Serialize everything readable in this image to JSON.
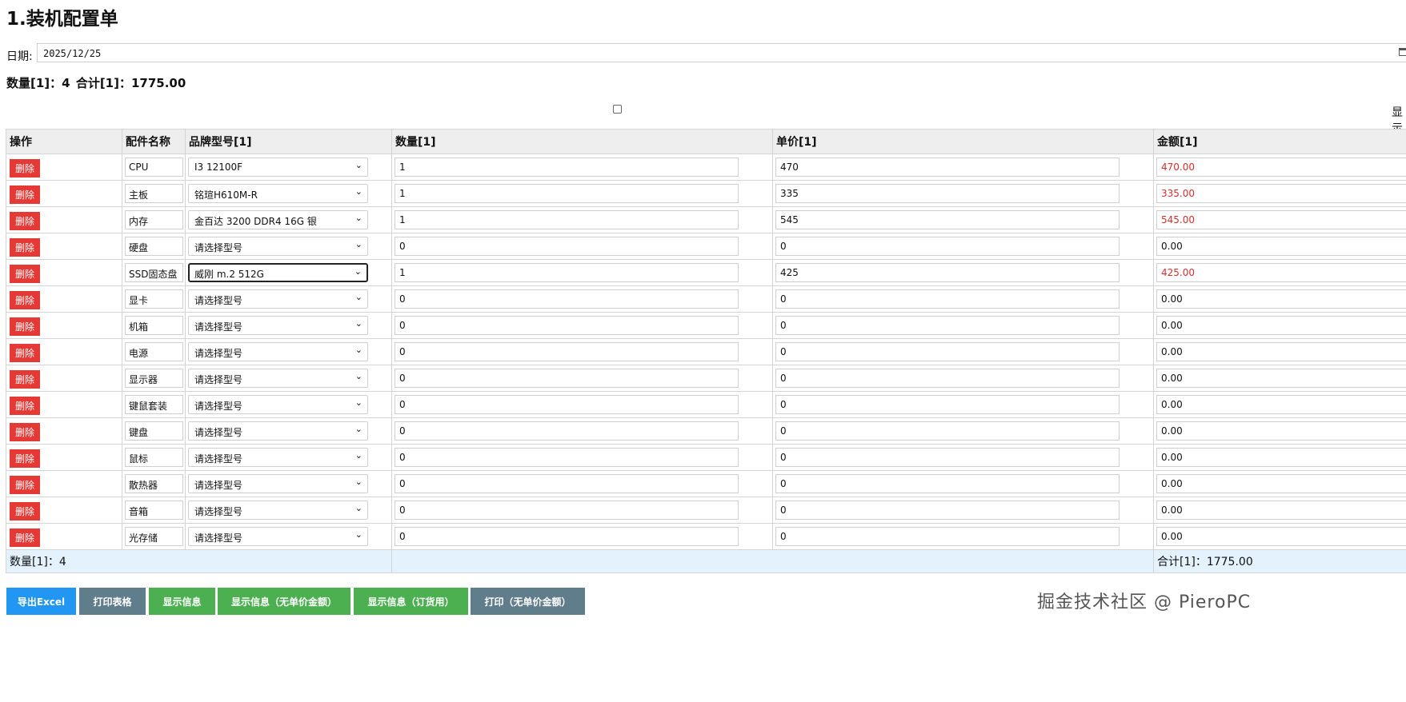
{
  "page": {
    "title": "1.装机配置单",
    "date_label": "日期:",
    "date_value": "2025/12/25",
    "summary_qty": "数量[1]：4",
    "summary_total": "合计[1]：1775.00",
    "toggle_text": "显示"
  },
  "table": {
    "headers": [
      "操作",
      "配件名称",
      "品牌型号[1]",
      "数量[1]",
      "单价[1]",
      "金额[1]"
    ],
    "delete_label": "删除",
    "rows": [
      {
        "name": "CPU",
        "brand": "I3 12100F",
        "qty": "1",
        "price": "470",
        "amount": "470.00"
      },
      {
        "name": "主板",
        "brand": "铭瑄H610M-R",
        "qty": "1",
        "price": "335",
        "amount": "335.00"
      },
      {
        "name": "内存",
        "brand": "金百达 3200 DDR4 16G 银",
        "qty": "1",
        "price": "545",
        "amount": "545.00"
      },
      {
        "name": "硬盘",
        "brand": "请选择型号",
        "qty": "0",
        "price": "0",
        "amount": "0.00"
      },
      {
        "name": "SSD固态盘",
        "brand": "威刚 m.2 512G",
        "qty": "1",
        "price": "425",
        "amount": "425.00"
      },
      {
        "name": "显卡",
        "brand": "请选择型号",
        "qty": "0",
        "price": "0",
        "amount": "0.00"
      },
      {
        "name": "机箱",
        "brand": "请选择型号",
        "qty": "0",
        "price": "0",
        "amount": "0.00"
      },
      {
        "name": "电源",
        "brand": "请选择型号",
        "qty": "0",
        "price": "0",
        "amount": "0.00"
      },
      {
        "name": "显示器",
        "brand": "请选择型号",
        "qty": "0",
        "price": "0",
        "amount": "0.00"
      },
      {
        "name": "键鼠套装",
        "brand": "请选择型号",
        "qty": "0",
        "price": "0",
        "amount": "0.00"
      },
      {
        "name": "键盘",
        "brand": "请选择型号",
        "qty": "0",
        "price": "0",
        "amount": "0.00"
      },
      {
        "name": "鼠标",
        "brand": "请选择型号",
        "qty": "0",
        "price": "0",
        "amount": "0.00"
      },
      {
        "name": "散热器",
        "brand": "请选择型号",
        "qty": "0",
        "price": "0",
        "amount": "0.00"
      },
      {
        "name": "音箱",
        "brand": "请选择型号",
        "qty": "0",
        "price": "0",
        "amount": "0.00"
      },
      {
        "name": "光存储",
        "brand": "请选择型号",
        "qty": "0",
        "price": "0",
        "amount": "0.00"
      }
    ],
    "footer_qty": "数量[1]：4",
    "footer_total": "合计[1]：1775.00"
  },
  "buttons": [
    {
      "label": "导出Excel",
      "color": "#2196f3"
    },
    {
      "label": "打印表格",
      "color": "#607d8b"
    },
    {
      "label": "显示信息",
      "color": "#4caf50"
    },
    {
      "label": "显示信息（无单价金额）",
      "color": "#4caf50"
    },
    {
      "label": "显示信息（订货用）",
      "color": "#4caf50"
    },
    {
      "label": "打印（无单价金额）",
      "color": "#607d8b"
    }
  ],
  "watermark": "掘金技术社区 @ PieroPC",
  "colors": {
    "delete": "#e53935",
    "amount_nonzero": "#d32f2f",
    "footer_bg": "#e3f2fd"
  }
}
